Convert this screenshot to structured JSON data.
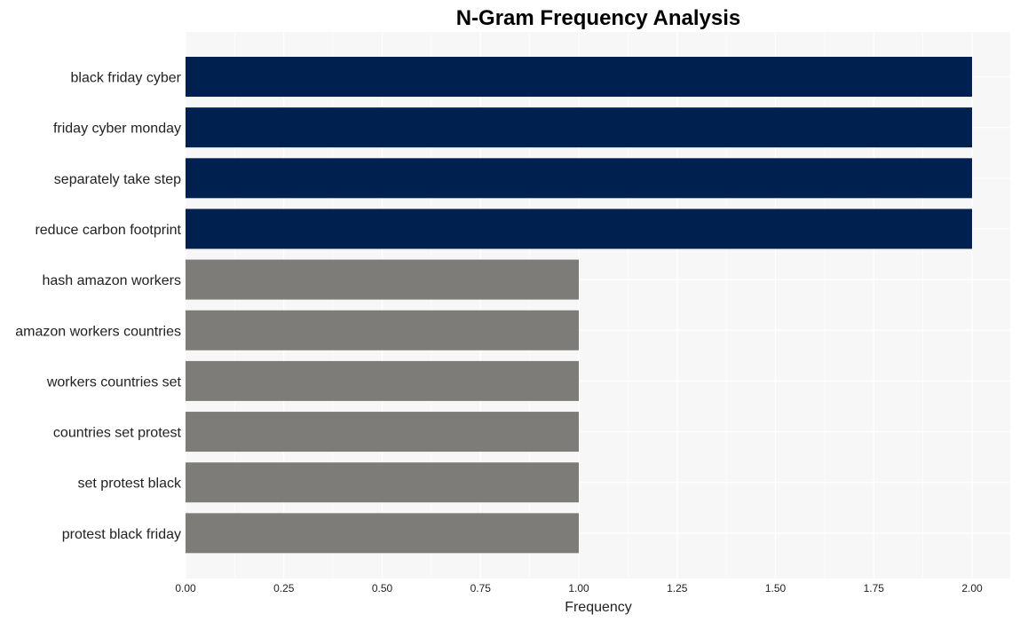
{
  "chart_data": {
    "type": "bar",
    "orientation": "horizontal",
    "title": "N-Gram Frequency Analysis",
    "xlabel": "Frequency",
    "ylabel": "",
    "xlim": [
      0,
      2.1
    ],
    "xticks": [
      0.0,
      0.25,
      0.5,
      0.75,
      1.0,
      1.25,
      1.5,
      1.75,
      2.0
    ],
    "xtick_labels": [
      "0.00",
      "0.25",
      "0.50",
      "0.75",
      "1.00",
      "1.25",
      "1.50",
      "1.75",
      "2.00"
    ],
    "grid": true,
    "categories": [
      "black friday cyber",
      "friday cyber monday",
      "separately take step",
      "reduce carbon footprint",
      "hash amazon workers",
      "amazon workers countries",
      "workers countries set",
      "countries set protest",
      "set protest black",
      "protest black friday"
    ],
    "values": [
      2,
      2,
      2,
      2,
      1,
      1,
      1,
      1,
      1,
      1
    ],
    "colors": {
      "high": "#00204f",
      "low": "#7d7c78",
      "panel_background": "#f7f7f7",
      "gridline": "#ffffff"
    }
  }
}
